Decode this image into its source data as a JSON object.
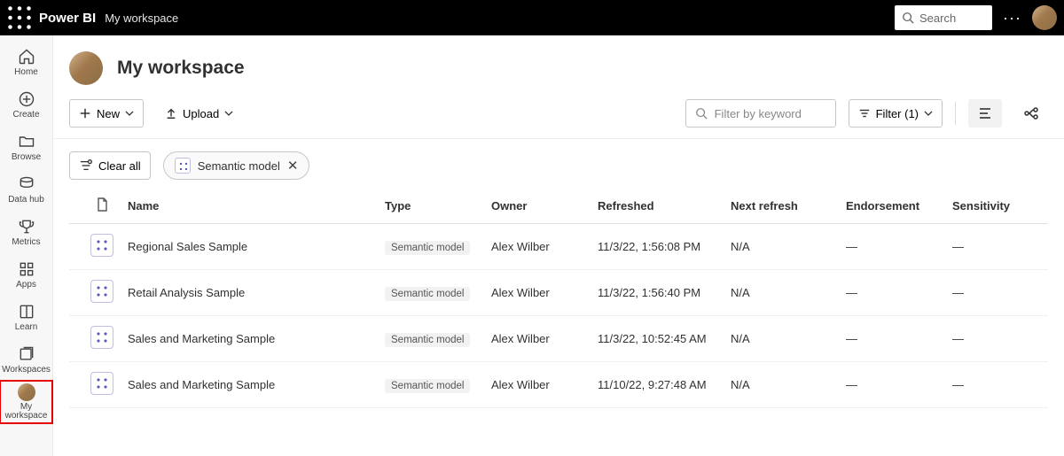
{
  "topbar": {
    "brand": "Power BI",
    "breadcrumb": "My workspace",
    "search_placeholder": "Search"
  },
  "leftnav": {
    "home": "Home",
    "create": "Create",
    "browse": "Browse",
    "datahub": "Data hub",
    "metrics": "Metrics",
    "apps": "Apps",
    "learn": "Learn",
    "workspaces": "Workspaces",
    "myworkspace": "My workspace"
  },
  "workspace": {
    "title": "My workspace"
  },
  "toolbar": {
    "new": "New",
    "upload": "Upload",
    "filter_placeholder": "Filter by keyword",
    "filter_label": "Filter (1)"
  },
  "pillrow": {
    "clearall": "Clear all",
    "filter_chip": "Semantic model"
  },
  "columns": {
    "name": "Name",
    "type": "Type",
    "owner": "Owner",
    "refreshed": "Refreshed",
    "nextrefresh": "Next refresh",
    "endorsement": "Endorsement",
    "sensitivity": "Sensitivity"
  },
  "rows": [
    {
      "name": "Regional Sales Sample",
      "type": "Semantic model",
      "owner": "Alex Wilber",
      "refreshed": "11/3/22, 1:56:08 PM",
      "next": "N/A",
      "endorse": "—",
      "sens": "—"
    },
    {
      "name": "Retail Analysis Sample",
      "type": "Semantic model",
      "owner": "Alex Wilber",
      "refreshed": "11/3/22, 1:56:40 PM",
      "next": "N/A",
      "endorse": "—",
      "sens": "—"
    },
    {
      "name": "Sales and Marketing Sample",
      "type": "Semantic model",
      "owner": "Alex Wilber",
      "refreshed": "11/3/22, 10:52:45 AM",
      "next": "N/A",
      "endorse": "—",
      "sens": "—"
    },
    {
      "name": "Sales and Marketing Sample",
      "type": "Semantic model",
      "owner": "Alex Wilber",
      "refreshed": "11/10/22, 9:27:48 AM",
      "next": "N/A",
      "endorse": "—",
      "sens": "—"
    }
  ]
}
